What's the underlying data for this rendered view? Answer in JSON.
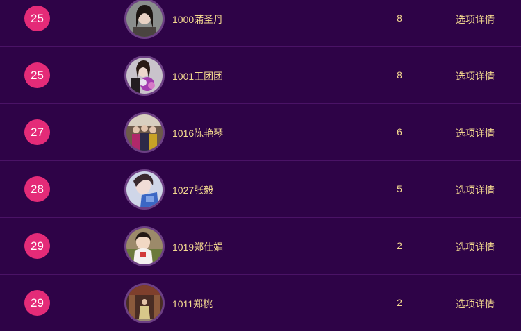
{
  "rows": [
    {
      "rank": "25",
      "name": "1000蒲圣丹",
      "votes": "8",
      "detail": "选项详情",
      "avatar": "avatar-photo-woman"
    },
    {
      "rank": "25",
      "name": "1001王团团",
      "votes": "8",
      "detail": "选项详情",
      "avatar": "avatar-photo-woman-flowers"
    },
    {
      "rank": "27",
      "name": "1016陈艳琴",
      "votes": "6",
      "detail": "选项详情",
      "avatar": "avatar-photo-group"
    },
    {
      "rank": "28",
      "name": "1027张毅",
      "votes": "5",
      "detail": "选项详情",
      "avatar": "avatar-photo-woman"
    },
    {
      "rank": "29",
      "name": "1019郑仕娟",
      "votes": "2",
      "detail": "选项详情",
      "avatar": "avatar-photo-child"
    },
    {
      "rank": "29",
      "name": "1011郑桃",
      "votes": "2",
      "detail": "选项详情",
      "avatar": "avatar-photo-woman-standing"
    }
  ],
  "colors": {
    "background": "#2e0347",
    "rank_badge": "#e42b78",
    "text": "#f3d88f",
    "divider": "#4a1366"
  }
}
